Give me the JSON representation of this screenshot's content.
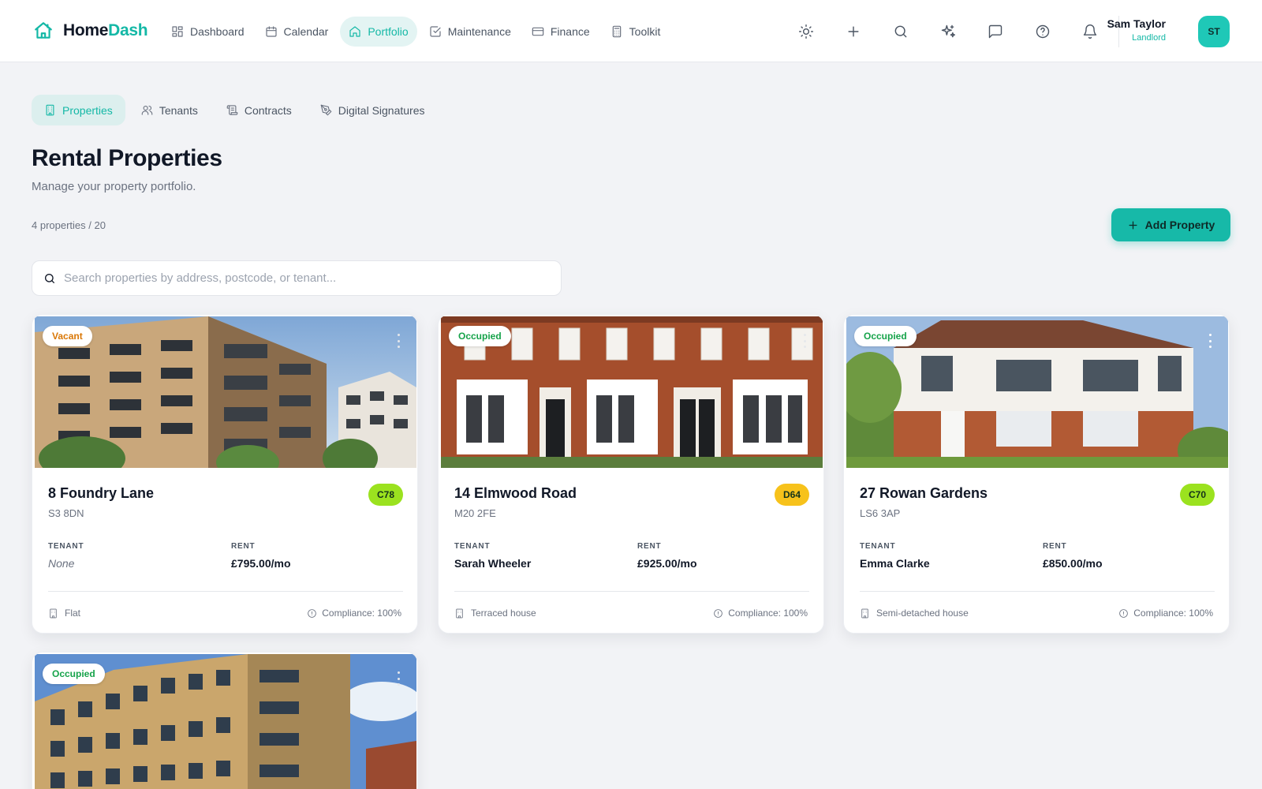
{
  "app": {
    "brand_home": "Home",
    "brand_dash": "Dash",
    "accent": "#14b8a6"
  },
  "nav": {
    "items": [
      {
        "label": "Dashboard",
        "icon": "dashboard-icon"
      },
      {
        "label": "Calendar",
        "icon": "calendar-icon"
      },
      {
        "label": "Portfolio",
        "icon": "home-icon",
        "active": true
      },
      {
        "label": "Maintenance",
        "icon": "checkbox-icon"
      },
      {
        "label": "Finance",
        "icon": "credit-card-icon"
      },
      {
        "label": "Toolkit",
        "icon": "calculator-icon"
      }
    ]
  },
  "toolbar": {
    "icons": [
      "sun-icon",
      "plus-icon",
      "search-icon",
      "sparkles-icon",
      "chat-icon",
      "help-icon",
      "bell-icon"
    ]
  },
  "user": {
    "name": "Sam Taylor",
    "role": "Landlord",
    "initials": "ST"
  },
  "subtabs": [
    {
      "label": "Properties",
      "icon": "building-icon",
      "active": true
    },
    {
      "label": "Tenants",
      "icon": "users-icon"
    },
    {
      "label": "Contracts",
      "icon": "scroll-icon"
    },
    {
      "label": "Digital Signatures",
      "icon": "pen-icon"
    }
  ],
  "page": {
    "title": "Rental Properties",
    "subtitle": "Manage your property portfolio.",
    "count": "4 properties / 20",
    "add_button": "Add Property",
    "search_placeholder": "Search properties by address, postcode, or tenant..."
  },
  "labels": {
    "tenant": "TENANT",
    "rent": "RENT"
  },
  "properties": [
    {
      "status": "Vacant",
      "address": "8 Foundry Lane",
      "postcode": "S3 8DN",
      "epc": "C78",
      "tenant": "None",
      "rent": "£795.00/mo",
      "type": "Flat",
      "compliance": "Compliance: 100%"
    },
    {
      "status": "Occupied",
      "address": "14 Elmwood Road",
      "postcode": "M20 2FE",
      "epc": "D64",
      "tenant": "Sarah Wheeler",
      "rent": "£925.00/mo",
      "type": "Terraced house",
      "compliance": "Compliance: 100%"
    },
    {
      "status": "Occupied",
      "address": "27 Rowan Gardens",
      "postcode": "LS6 3AP",
      "epc": "C70",
      "tenant": "Emma Clarke",
      "rent": "£850.00/mo",
      "type": "Semi-detached house",
      "compliance": "Compliance: 100%"
    },
    {
      "status": "Occupied"
    }
  ],
  "colors": {
    "vacant": "#d97706",
    "occupied": "#16a34a",
    "epc_c": "#9be21f",
    "epc_d": "#f7c21b"
  }
}
